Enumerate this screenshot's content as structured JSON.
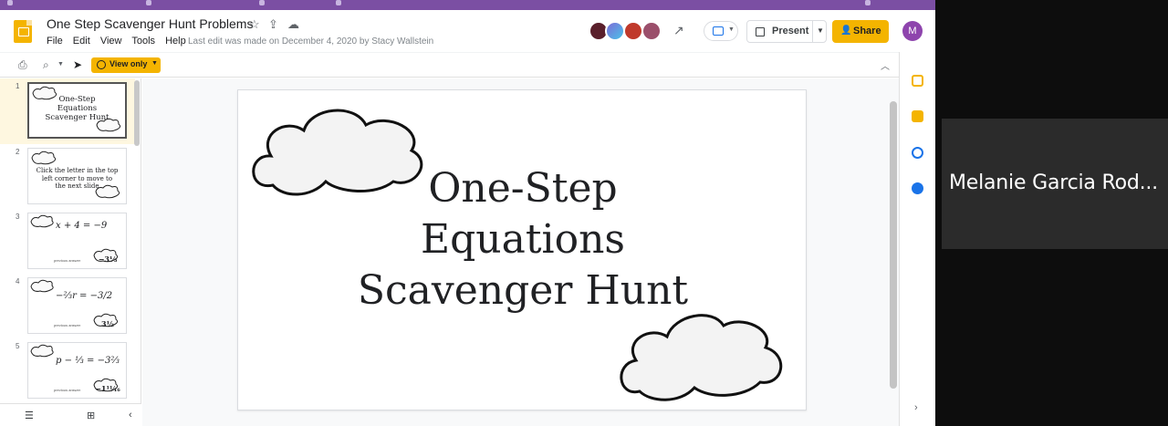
{
  "header": {
    "doc_title": "One Step Scavenger Hunt Problems",
    "menu": [
      "File",
      "Edit",
      "View",
      "Tools",
      "Help"
    ],
    "last_edit": "Last edit was made on December 4, 2020 by Stacy Wallstein",
    "present_label": "Present",
    "share_label": "Share",
    "account_initial": "M"
  },
  "toolbar": {
    "view_only_label": "View only"
  },
  "filmstrip": {
    "slides": [
      {
        "num": "1",
        "lines": [
          "One-Step",
          "Equations",
          "Scavenger Hunt"
        ]
      },
      {
        "num": "2",
        "lines": [
          "Click the letter in the top",
          "left corner to move to",
          "the next slide"
        ]
      },
      {
        "num": "3",
        "equation": "x + 4 = −9",
        "prev_label": "previous answer",
        "answer": "−3⅓"
      },
      {
        "num": "4",
        "equation": "−⅔r = −3/2",
        "prev_label": "previous answer",
        "answer": "3½"
      },
      {
        "num": "5",
        "equation": "p − ⅓ = −3⅔",
        "prev_label": "previous answer",
        "answer": "−1¹¹⁄₁₆"
      }
    ]
  },
  "slide": {
    "title_lines": [
      "One-Step",
      "Equations",
      "Scavenger Hunt"
    ]
  },
  "video": {
    "participant_name": "Melanie Garcia Rod..."
  },
  "colors": {
    "brand_purple": "#7b4fa3",
    "slides_yellow": "#f4b400",
    "video_bg": "#2b2b2b"
  },
  "icons": [
    "slides-logo-icon",
    "star-icon",
    "move-icon",
    "cloud-status-icon",
    "trend-icon",
    "chat-icon",
    "present-icon",
    "share-icon",
    "print-icon",
    "zoom-icon",
    "select-cursor-icon",
    "eye-icon",
    "collapse-icon",
    "grid-view-icon",
    "list-view-icon",
    "calendar-icon",
    "keep-icon",
    "tasks-icon",
    "contacts-icon"
  ]
}
